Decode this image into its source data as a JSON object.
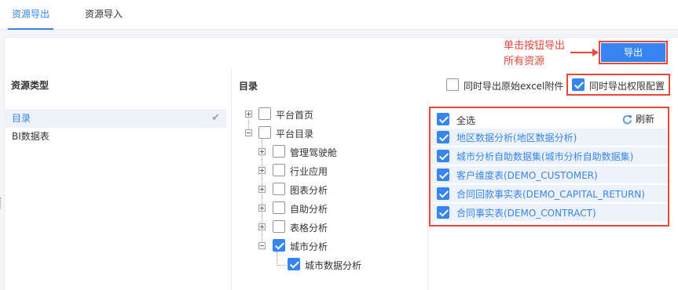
{
  "tabs": [
    {
      "label": "资源导出",
      "active": true
    },
    {
      "label": "资源导入",
      "active": false
    }
  ],
  "export_button": "导出",
  "annotation": {
    "line1": "单击按钮导出",
    "line2": "所有资源",
    "color": "#e8473c"
  },
  "resource_type": {
    "heading": "资源类型",
    "items": [
      {
        "label": "目录",
        "selected": true
      },
      {
        "label": "BI数据表",
        "selected": false
      }
    ]
  },
  "catalog": {
    "heading": "目录",
    "options": [
      {
        "label": "同时导出原始excel附件",
        "checked": false
      },
      {
        "label": "同时导出权限配置",
        "checked": true
      }
    ],
    "tree": [
      {
        "label": "平台首页",
        "level": 0,
        "expander": "plus",
        "checked": false
      },
      {
        "label": "平台目录",
        "level": 0,
        "expander": "minus",
        "checked": false
      },
      {
        "label": "管理驾驶舱",
        "level": 1,
        "expander": "plus",
        "checked": false
      },
      {
        "label": "行业应用",
        "level": 1,
        "expander": "plus",
        "checked": false
      },
      {
        "label": "图表分析",
        "level": 1,
        "expander": "plus",
        "checked": false
      },
      {
        "label": "自助分析",
        "level": 1,
        "expander": "plus",
        "checked": false
      },
      {
        "label": "表格分析",
        "level": 1,
        "expander": "plus",
        "checked": false
      },
      {
        "label": "城市分析",
        "level": 1,
        "expander": "minus",
        "checked": true
      },
      {
        "label": "城市数据分析",
        "level": 2,
        "expander": "none",
        "checked": true
      }
    ]
  },
  "selected_panel": {
    "select_all": "全选",
    "select_all_checked": true,
    "refresh": "刷新",
    "items": [
      {
        "label": "地区数据分析(地区数据分析)",
        "checked": true
      },
      {
        "label": "城市分析自助数据集(城市分析自助数据集)",
        "checked": true
      },
      {
        "label": "客户维度表(DEMO_CUSTOMER)",
        "checked": true
      },
      {
        "label": "合同回款事实表(DEMO_CAPITAL_RETURN)",
        "checked": true
      },
      {
        "label": "合同事实表(DEMO_CONTRACT)",
        "checked": true
      }
    ]
  },
  "colors": {
    "accent": "#3685f2",
    "highlight": "#e8473c",
    "selected_bg": "#eef3fb"
  }
}
